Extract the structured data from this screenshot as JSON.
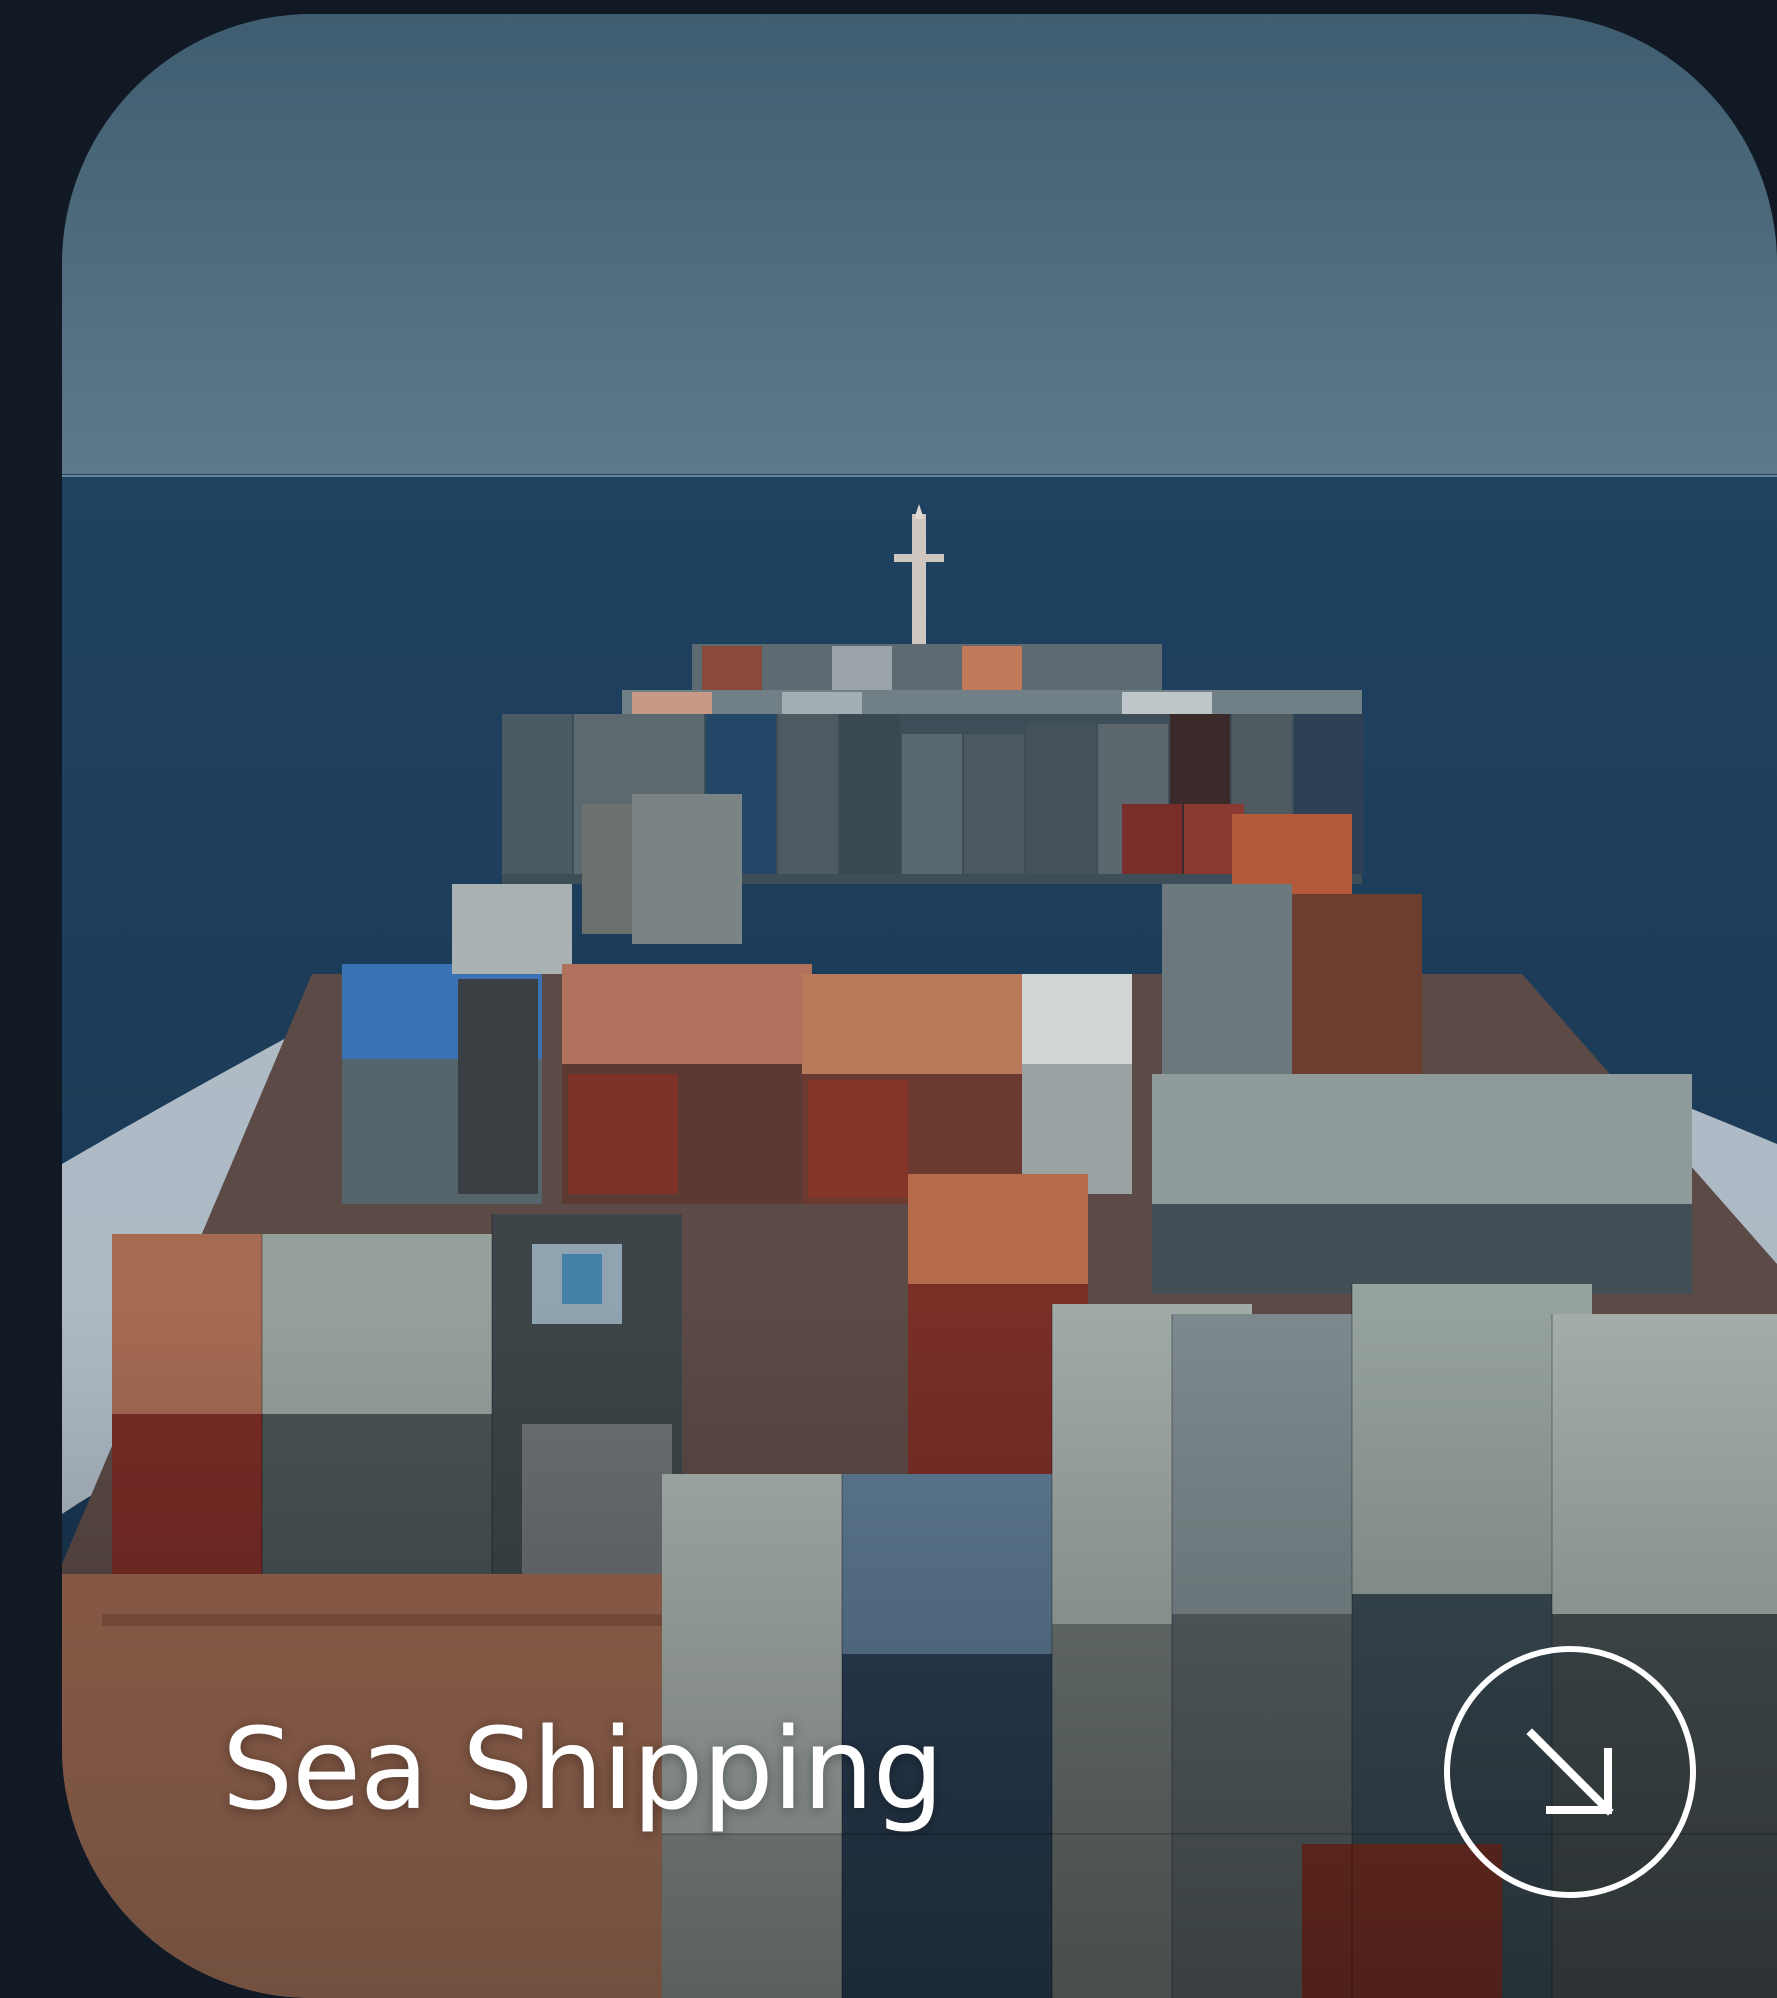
{
  "card": {
    "title": "Sea Shipping",
    "action_icon": "arrow-down-right-icon"
  },
  "colors": {
    "page_background": "#111a24",
    "sky": "#4c6a7c",
    "sea": "#1d3e5c",
    "deck": "#a36e55",
    "text": "#ffffff"
  }
}
